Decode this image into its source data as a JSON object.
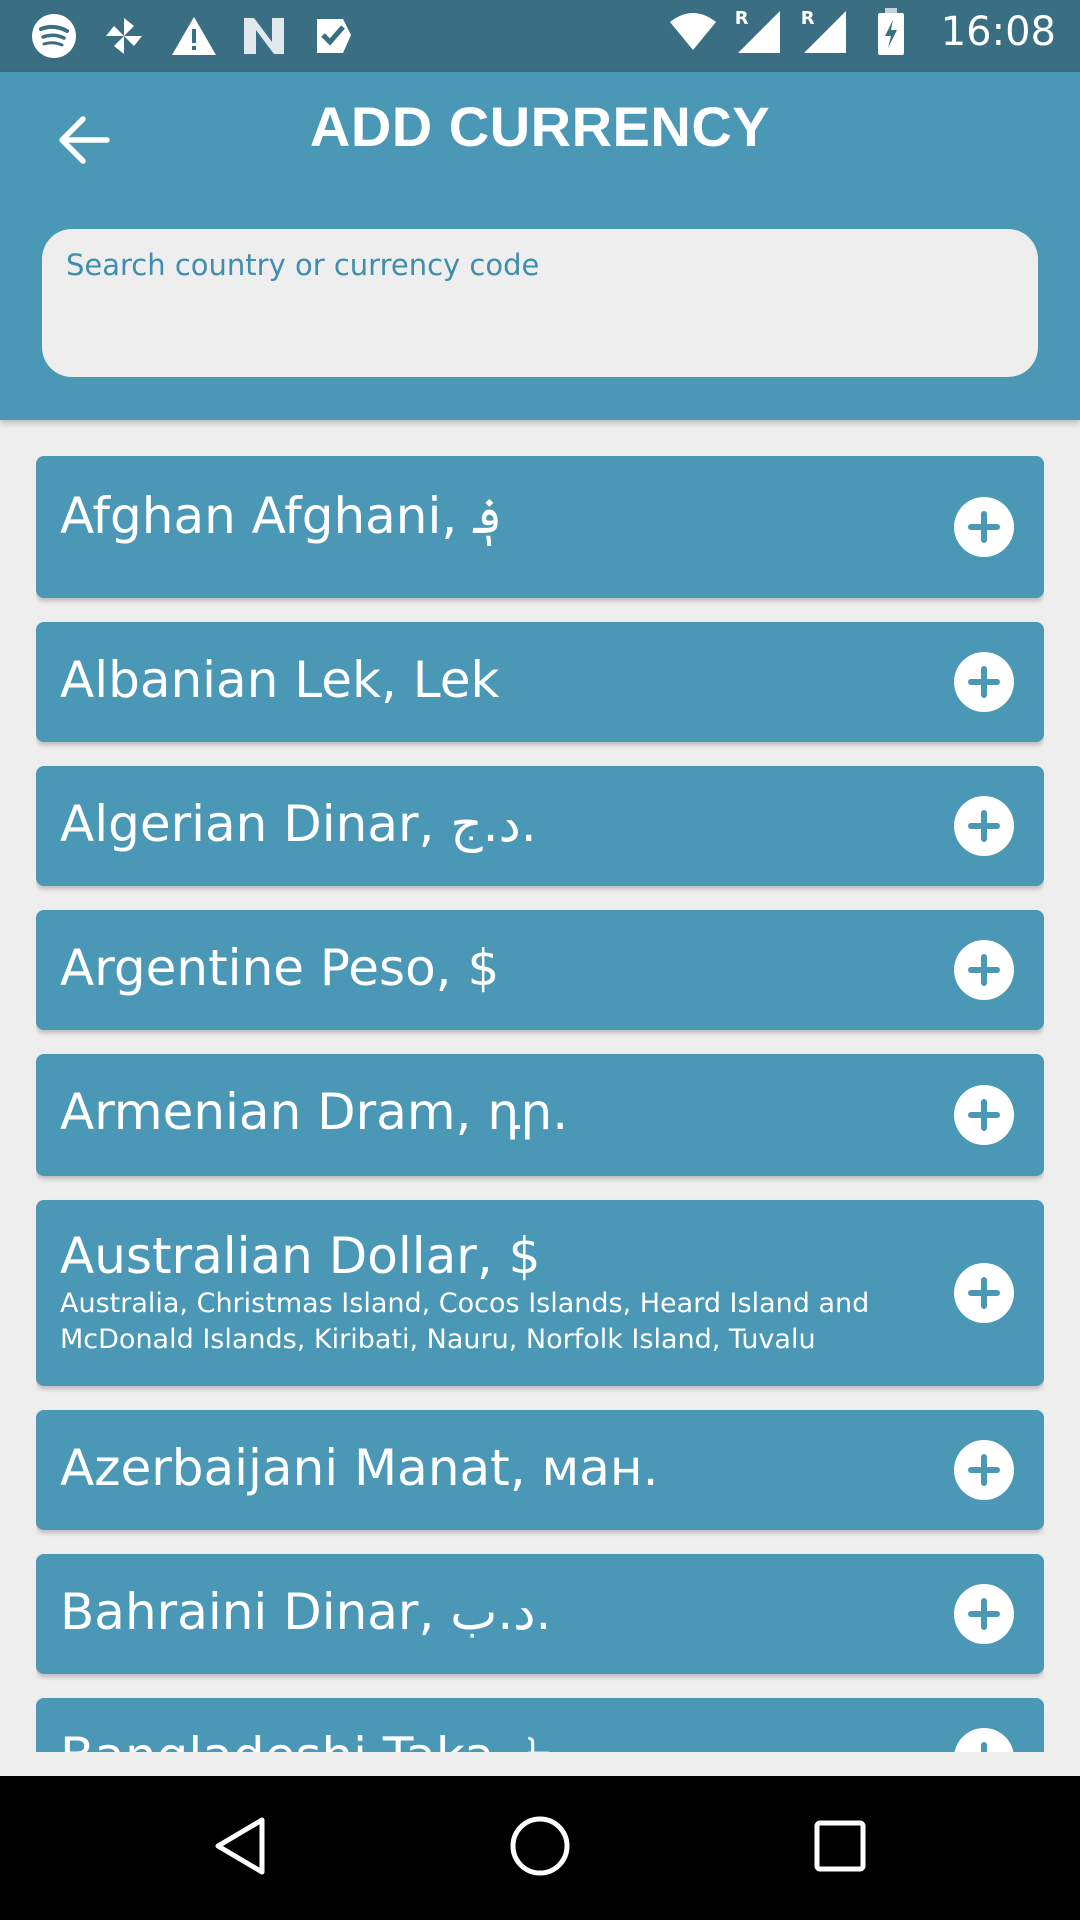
{
  "status_bar": {
    "time": "16:08",
    "left_icons": [
      "spotify-icon",
      "pinwheel-icon",
      "warning-icon",
      "n-app-icon",
      "check-icon"
    ],
    "right_icons": [
      "wifi-icon",
      "signal-roaming-icon",
      "signal-roaming-icon",
      "battery-charging-icon"
    ],
    "roaming_label": "R"
  },
  "header": {
    "title": "ADD CURRENCY",
    "back_icon": "arrow-back-icon"
  },
  "search": {
    "placeholder": "Search country or currency code",
    "value": ""
  },
  "currencies": [
    {
      "label": "Afghan Afghani, ؋"
    },
    {
      "label": "Albanian Lek, Lek"
    },
    {
      "label": "Algerian Dinar, د.ج."
    },
    {
      "label": "Argentine Peso, $"
    },
    {
      "label": "Armenian Dram, դր."
    },
    {
      "label": "Australian Dollar, $",
      "countries": "Australia, Christmas Island, Cocos Islands, Heard Island and McDonald Islands, Kiribati, Nauru, Norfolk Island, Tuvalu"
    },
    {
      "label": "Azerbaijani Manat, ман."
    },
    {
      "label": "Bahraini Dinar, د.ب."
    },
    {
      "label": "Bangladeshi Taka, ৳"
    }
  ],
  "nav_bar": {
    "icons": [
      "back-triangle-icon",
      "home-circle-icon",
      "recents-square-icon"
    ]
  },
  "colors": {
    "status_bar": "#3A6F83",
    "primary": "#4A98B5",
    "background": "#EEEEEE",
    "nav_bar": "#000000"
  }
}
